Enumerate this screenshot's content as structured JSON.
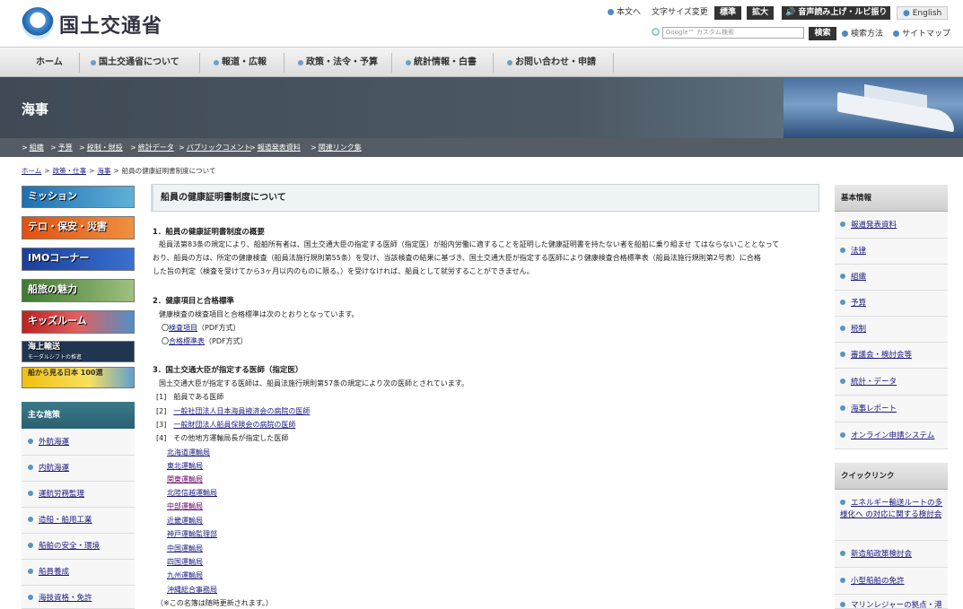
{
  "header": {
    "logo_text": "国土交通省",
    "skip_link": "本文へ",
    "font_size_label": "文字サイズ変更",
    "font_standard": "標準",
    "font_large": "拡大",
    "audio_button": "音声読み上げ・ルビ振り",
    "english_link": "English",
    "search_placeholder": "Google™ カスタム検索",
    "search_button": "検索",
    "search_help": "検索方法",
    "sitemap": "サイトマップ"
  },
  "nav": [
    "ホーム",
    "国土交通省について",
    "報道・広報",
    "政策・法令・予算",
    "統計情報・白書",
    "お問い合わせ・申請"
  ],
  "banner": {
    "title": "海事"
  },
  "subnav": [
    "組織",
    "予算",
    "税制・財投",
    "統計データ",
    "パブリックコメント",
    "報道発表資料",
    "関連リンク集"
  ],
  "breadcrumb": [
    "ホーム",
    "政策・仕事",
    "海事",
    "船員の健康証明書制度について"
  ],
  "left_banners": [
    "ミッション",
    "テロ・保安・災害",
    "IMOコーナー",
    "船旅の魅力",
    "キッズルーム",
    "海上輸送",
    "船から見る日本 100選"
  ],
  "left_banner_sub": "モーダルシフトの推進",
  "left_menu": {
    "heading": "主な施策",
    "items": [
      "外航海運",
      "内航海運",
      "運航労務監理",
      "造船・舶用工業",
      "船舶の安全・環境",
      "船員養成",
      "海技資格・免許"
    ]
  },
  "main": {
    "title": "船員の健康証明書制度について",
    "s1_heading": "1．船員の健康証明書制度の概要",
    "s1_p1": "船員法第83条の規定により、船舶所有者は、国土交通大臣の指定する医師（指定医）が船内労働に適することを証明した健康証明書を持たない者を船舶に乗り組ませ てはならないこととなって",
    "s1_p2": "おり、船員の方は、所定の健康検査（船員法施行規則第55条）を受け、当該検査の結果に基づき、国土交通大臣が指定する医師により健康検査合格標準表（船員法施行規則第2号表）に合格",
    "s1_p3": "した旨の判定（検査を受けてから3ヶ月以内のものに限る。）を受けなければ、船員として就労することができません。",
    "s2_heading": "2．健康項目と合格標準",
    "s2_p1": "健康検査の検査項目と合格標準は次のとおりとなっています。",
    "s2_link1_prefix": "〇",
    "s2_link1": "検査項目",
    "s2_link1_suffix": "（PDF方式）",
    "s2_link2_prefix": "〇",
    "s2_link2": "合格標準表",
    "s2_link2_suffix": "（PDF方式）",
    "s3_heading": "3．国土交通大臣が指定する医師（指定医）",
    "s3_p1": "国土交通大臣が指定する医師は、船員法施行規則第57条の規定により次の医師とされています。",
    "s3_i1": "[1]　船員である医師",
    "s3_i2_prefix": "[2]　",
    "s3_i2": "一般社団法人日本海員掖済会の病院の医師",
    "s3_i3_prefix": "[3]　",
    "s3_i3": "一般財団法人船員保険会の病院の医師",
    "s3_i4": "[4]　その他地方運輸局長が指定した医師",
    "bureaus": [
      "北海道運輸局",
      "東北運輸局",
      "関東運輸局",
      "北陸信越運輸局",
      "中部運輸局",
      "近畿運輸局",
      "神戸運輸監理部",
      "中国運輸局",
      "四国運輸局",
      "九州運輸局",
      "沖縄総合事務局"
    ],
    "note": "（※この名簿は随時更新されます。）"
  },
  "right_basic": {
    "heading": "基本情報",
    "items": [
      "報道発表資料",
      "法律",
      "組織",
      "予算",
      "税制",
      "審議会・検討会等",
      "統計・データ",
      "海事レポート",
      "オンライン申請システム"
    ]
  },
  "right_quick": {
    "heading": "クイックリンク",
    "items": [
      "エネルギー輸送ルートの多様化へ の対応に関する検討会",
      "新造船政策検討会",
      "小型船舶の免許",
      "マリンレジャーの拠点・港"
    ]
  },
  "colors": {
    "accent": "#2b6070",
    "nav_bg": "#e6e6e6",
    "banner": "#4c5964"
  }
}
